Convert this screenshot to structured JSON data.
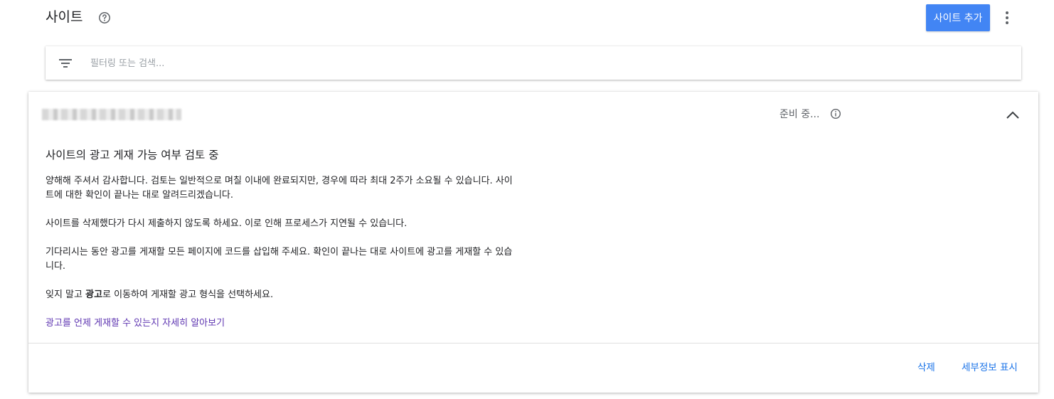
{
  "header": {
    "title": "사이트",
    "add_site_label": "사이트 추가"
  },
  "search": {
    "placeholder": "필터링 또는 검색..."
  },
  "site_card": {
    "status": "준비 중...",
    "review_title": "사이트의 광고 게재 가능 여부 검토 중",
    "paragraph1": "양해해 주셔서 감사합니다. 검토는 일반적으로 며칠 이내에 완료되지만, 경우에 따라 최대 2주가 소요될 수 있습니다. 사이트에 대한 확인이 끝나는 대로 알려드리겠습니다.",
    "paragraph2": "사이트를 삭제했다가 다시 제출하지 않도록 하세요. 이로 인해 프로세스가 지연될 수 있습니다.",
    "paragraph3": "기다리시는 동안 광고를 게재할 모든 페이지에 코드를 삽입해 주세요. 확인이 끝나는 대로 사이트에 광고를 게재할 수 있습니다.",
    "paragraph4_prefix": "잊지 말고 ",
    "paragraph4_bold": "광고",
    "paragraph4_suffix": "로 이동하여 게재할 광고 형식을 선택하세요.",
    "learn_more_link": "광고를 언제 게재할 수 있는지 자세히 알아보기",
    "delete_label": "삭제",
    "details_label": "세부정보 표시"
  },
  "colors": {
    "primary_button": "#4285f4",
    "link": "#5e35b1",
    "action": "#1a73e8"
  },
  "icons": [
    "help-icon",
    "more-vert-icon",
    "filter-icon",
    "info-icon",
    "chevron-up-icon"
  ]
}
